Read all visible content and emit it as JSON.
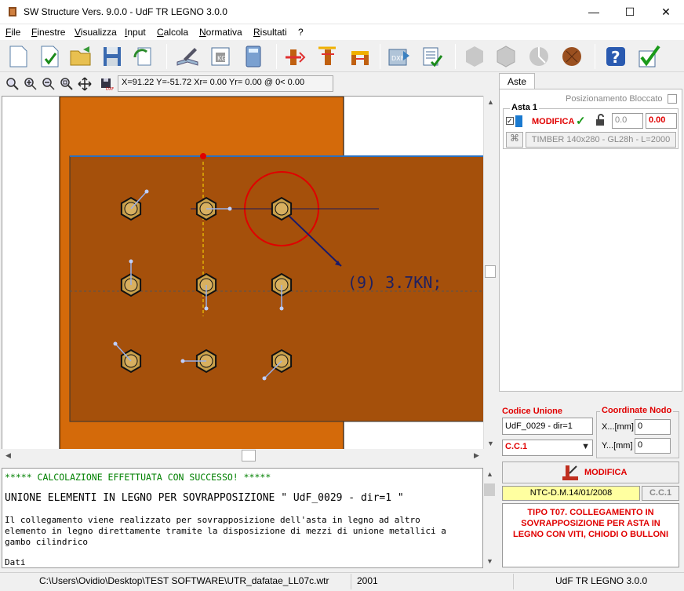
{
  "window": {
    "title": "SW Structure Vers. 9.0.0 - UdF TR LEGNO 3.0.0",
    "minimize": "—",
    "maximize": "☐",
    "close": "✕"
  },
  "menu": [
    {
      "label": "File",
      "ul": "F",
      "rest": "ile"
    },
    {
      "label": "Finestre",
      "ul": "F",
      "rest": "inestre"
    },
    {
      "label": "Visualizza",
      "ul": "V",
      "rest": "isualizza"
    },
    {
      "label": "Input",
      "ul": "I",
      "rest": "nput"
    },
    {
      "label": "Calcola",
      "ul": "C",
      "rest": "alcola"
    },
    {
      "label": "Normativa",
      "ul": "N",
      "rest": "ormativa"
    },
    {
      "label": "Risultati",
      "ul": "R",
      "rest": "isultati"
    },
    {
      "label": "?",
      "ul": "",
      "rest": "?"
    }
  ],
  "coords": "X=91.22 Y=-51.72 Xr= 0.00 Yr= 0.00 @  0< 0.00",
  "canvas": {
    "force_label": "(9) 3.7KN;"
  },
  "output": {
    "line1": "***** CALCOLAZIONE EFFETTUATA CON SUCCESSO! *****",
    "line2": "UNIONE ELEMENTI IN LEGNO PER SOVRAPPOSIZIONE \" UdF_0029 - dir=1 \"",
    "line3": "Il collegamento viene realizzato per sovrapposizione dell'asta in legno ad altro",
    "line4": "elemento in legno direttamente tramite la disposizione di mezzi di unione metallici a",
    "line5": "gambo cilindrico",
    "line6": "Dati"
  },
  "panel": {
    "tab": "Aste",
    "locked_label": "Posizionamento Bloccato",
    "group": "Asta 1",
    "modifica": "MODIFICA",
    "val1": "0.0",
    "val2": "0.00",
    "element": "TIMBER 140x280 - GL28h - L=2000",
    "codice_label": "Codice Unione",
    "codice_value": "UdF_0029 - dir=1",
    "coord_label": "Coordinate Nodo",
    "x_label": "X...[mm]",
    "x_value": "0",
    "y_label": "Y...[mm]",
    "y_value": "0",
    "combo": "C.C.1",
    "modifica2": "MODIFICA",
    "norm": "NTC-D.M.14/01/2008",
    "cc": "C.C.1",
    "tipo": "TIPO T07. COLLEGAMENTO IN SOVRAPPOSIZIONE PER ASTA IN LEGNO CON VITI, CHIODI O BULLONI"
  },
  "status": {
    "path": "C:\\Users\\Ovidio\\Desktop\\TEST SOFTWARE\\UTR_dafatae_LL07c.wtr",
    "code": "2001",
    "app": "UdF TR LEGNO 3.0.0"
  },
  "colors": {
    "timber_light": "#d46a0a",
    "timber_dark": "#a5500b",
    "accent_red": "#e00000",
    "yellow": "#ffffa0"
  }
}
